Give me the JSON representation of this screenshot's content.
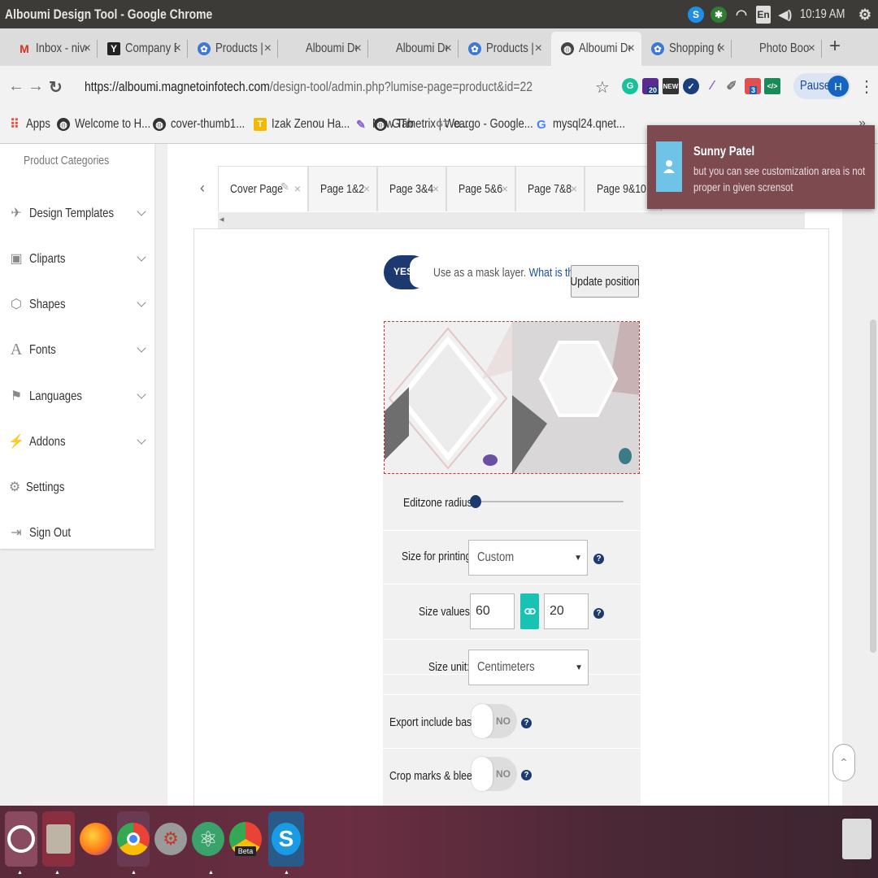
{
  "window": {
    "title": "Alboumi Design Tool - Google Chrome"
  },
  "tray": {
    "language": "En",
    "time": "10:19 AM"
  },
  "tabs": [
    {
      "label": "Inbox - nive",
      "icon": "gmail-icon",
      "color": "#d93025",
      "glyph": "M"
    },
    {
      "label": "Company D",
      "icon": "y-logo-icon",
      "color": "#222",
      "glyph": "Y"
    },
    {
      "label": "Products |",
      "icon": "colorful-logo-icon",
      "color": "#3c78d8",
      "glyph": "✿"
    },
    {
      "label": "Alboumi De",
      "icon": "page-icon",
      "color": "#999",
      "glyph": ""
    },
    {
      "label": "Alboumi De",
      "icon": "page-icon",
      "color": "#999",
      "glyph": ""
    },
    {
      "label": "Products |",
      "icon": "colorful-logo-icon",
      "color": "#3c78d8",
      "glyph": "✿"
    },
    {
      "label": "Alboumi De",
      "icon": "globe-icon",
      "color": "#444",
      "glyph": "◍"
    },
    {
      "label": "Shopping C",
      "icon": "colorful-logo-icon",
      "color": "#3c78d8",
      "glyph": "✿"
    },
    {
      "label": "Photo Boo",
      "icon": "page-icon",
      "color": "#999",
      "glyph": ""
    }
  ],
  "address": {
    "scheme_host": "https://alboumi.magnetoinfotech.com",
    "path": "/design-tool/admin.php?lumise-page=product&id=22"
  },
  "profile": {
    "status": "Paused",
    "initial": "H"
  },
  "extensions": {
    "badge1": "20",
    "badge2": "3"
  },
  "bookmarks": [
    {
      "label": "Apps",
      "icon": "apps-grid-icon",
      "color": "#e74c3c",
      "glyph": "⠿"
    },
    {
      "label": "Welcome to H...",
      "icon": "globe-icon",
      "color": "#333",
      "glyph": "◍"
    },
    {
      "label": "cover-thumb1...",
      "icon": "globe-icon",
      "color": "#333",
      "glyph": "◍"
    },
    {
      "label": "Izak Zenou Ha...",
      "icon": "bookmark-icon",
      "color": "#f5b800",
      "glyph": "T"
    },
    {
      "label": "New Tab",
      "icon": "feather-icon",
      "color": "#8a5cd0",
      "glyph": "✎"
    },
    {
      "label": "GTmetrix | We...",
      "icon": "globe-icon",
      "color": "#333",
      "glyph": "◍"
    },
    {
      "label": "cargo - Google...",
      "icon": "gt-icon",
      "color": "#777",
      "glyph": "GT"
    },
    {
      "label": "mysql24.qnet...",
      "icon": "google-icon",
      "color": "#4285f4",
      "glyph": "G"
    }
  ],
  "sidebar": {
    "heading": "Product Categories",
    "items": [
      {
        "label": "Design Templates",
        "icon": "paper-plane-icon",
        "glyph": "✈",
        "chevron": true
      },
      {
        "label": "Cliparts",
        "icon": "image-icon",
        "glyph": "▣",
        "chevron": true
      },
      {
        "label": "Shapes",
        "icon": "cube-icon",
        "glyph": "⬡",
        "chevron": true
      },
      {
        "label": "Fonts",
        "icon": "font-icon",
        "glyph": "A",
        "chevron": true
      },
      {
        "label": "Languages",
        "icon": "language-icon",
        "glyph": "⚑",
        "chevron": true
      },
      {
        "label": "Addons",
        "icon": "plug-icon",
        "glyph": "⚡",
        "chevron": true
      },
      {
        "label": "Settings",
        "icon": "gear-icon",
        "glyph": "⚙",
        "chevron": false
      },
      {
        "label": "Sign Out",
        "icon": "sign-out-icon",
        "glyph": "⇥",
        "chevron": false
      }
    ]
  },
  "page_tabs": [
    "Cover Page",
    "Page 1&2",
    "Page 3&4",
    "Page 5&6",
    "Page 7&8",
    "Page 9&10"
  ],
  "mask": {
    "toggle": "YES",
    "text": "Use as a mask layer.",
    "link": "What is this",
    "update_button": "Update position"
  },
  "settings": {
    "editzone_radius_label": "Editzone radius:",
    "editzone_radius_value": 0,
    "size_printing_label": "Size for printing:",
    "size_printing_value": "Custom",
    "size_values_label": "Size values:",
    "width": "60",
    "height": "20",
    "size_unit_label": "Size unit:",
    "size_unit_value": "Centimeters",
    "export_base_label": "Export include base:",
    "export_base_value": "NO",
    "crop_marks_label": "Crop marks & bleed:",
    "crop_marks_value": "NO"
  },
  "notification": {
    "name": "Sunny Patel",
    "message": "but you can see customization area is not proper in given scrensot"
  },
  "dock": [
    {
      "name": "ubuntu-icon",
      "color": "#e05a30"
    },
    {
      "name": "files-icon",
      "color": "#9a8f82"
    },
    {
      "name": "firefox-icon",
      "color": "#ff7a1a"
    },
    {
      "name": "chrome-icon",
      "color": "#34a853"
    },
    {
      "name": "settings-tool-icon",
      "color": "#b0b0b0"
    },
    {
      "name": "atom-icon",
      "color": "#3aa36b"
    },
    {
      "name": "chrome-beta-icon",
      "color": "#c0392b",
      "label": "Beta"
    },
    {
      "name": "skype-icon",
      "color": "#1a9be6"
    },
    {
      "name": "trash-icon",
      "color": "#bcbcbc"
    }
  ],
  "colors": {
    "accent": "#1d3a70",
    "teal": "#19c3b3",
    "notification_bg": "#7d4a50"
  }
}
